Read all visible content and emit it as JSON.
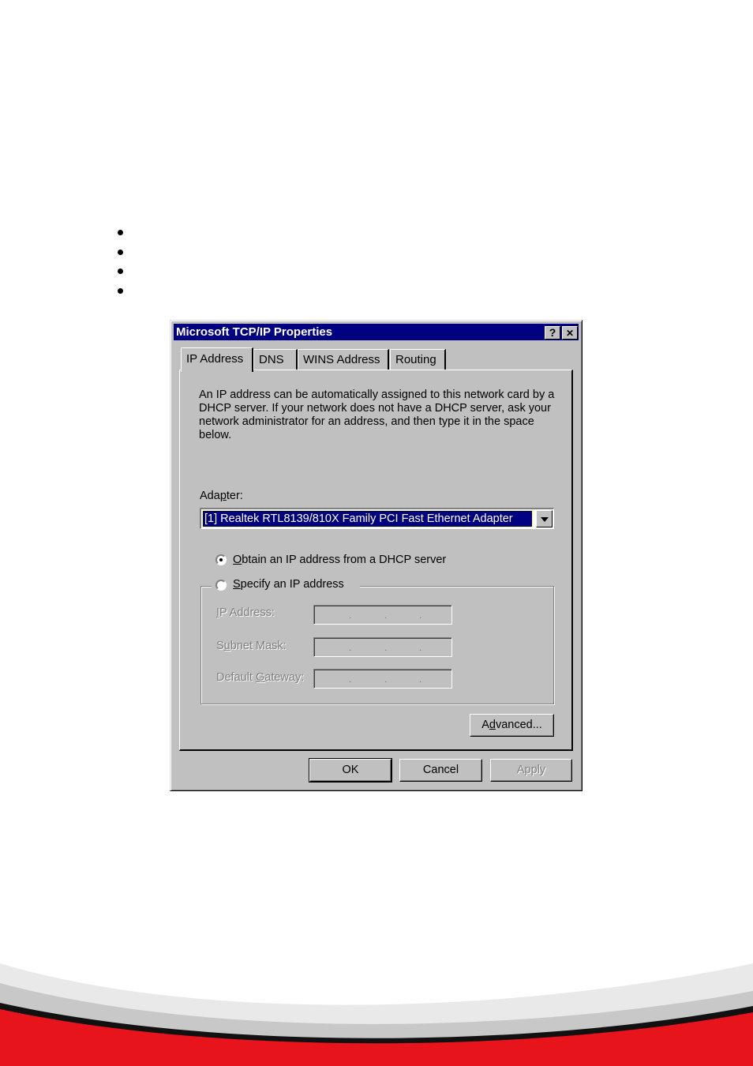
{
  "window": {
    "title": "Microsoft TCP/IP Properties",
    "help_button": "?",
    "close_button": "✕"
  },
  "tabs": [
    {
      "label": "IP Address",
      "active": true
    },
    {
      "label": "DNS",
      "active": false
    },
    {
      "label": "WINS Address",
      "active": false
    },
    {
      "label": "Routing",
      "active": false
    }
  ],
  "description": "An IP address can be automatically assigned to this network card by a DHCP server.  If your network does not have a DHCP server, ask your network administrator for an address, and then type it in the space below.",
  "adapter": {
    "label_pre": "Ada",
    "label_mnemonic": "p",
    "label_post": "ter:",
    "selected": "[1] Realtek RTL8139/810X Family PCI Fast Ethernet Adapter"
  },
  "radio_dhcp": {
    "mnemonic": "O",
    "rest": "btain an IP address from a DHCP server",
    "checked": true
  },
  "radio_specify": {
    "mnemonic": "S",
    "rest": "pecify an IP address",
    "checked": false
  },
  "fields": {
    "ip_address": {
      "mnemonic": "I",
      "rest": "P Address:"
    },
    "subnet_mask": {
      "pre": "S",
      "mnemonic": "u",
      "rest": "bnet Mask:"
    },
    "gateway": {
      "pre": "Default ",
      "mnemonic": "G",
      "rest": "ateway:"
    },
    "separator": "."
  },
  "buttons": {
    "advanced_pre": "A",
    "advanced_mnemonic": "d",
    "advanced_rest": "vanced...",
    "ok": "OK",
    "cancel": "Cancel",
    "apply": "Apply"
  },
  "colors": {
    "titlebar": "#000080",
    "dialog": "#c0c0c0",
    "footer_red": "#e8141b"
  }
}
